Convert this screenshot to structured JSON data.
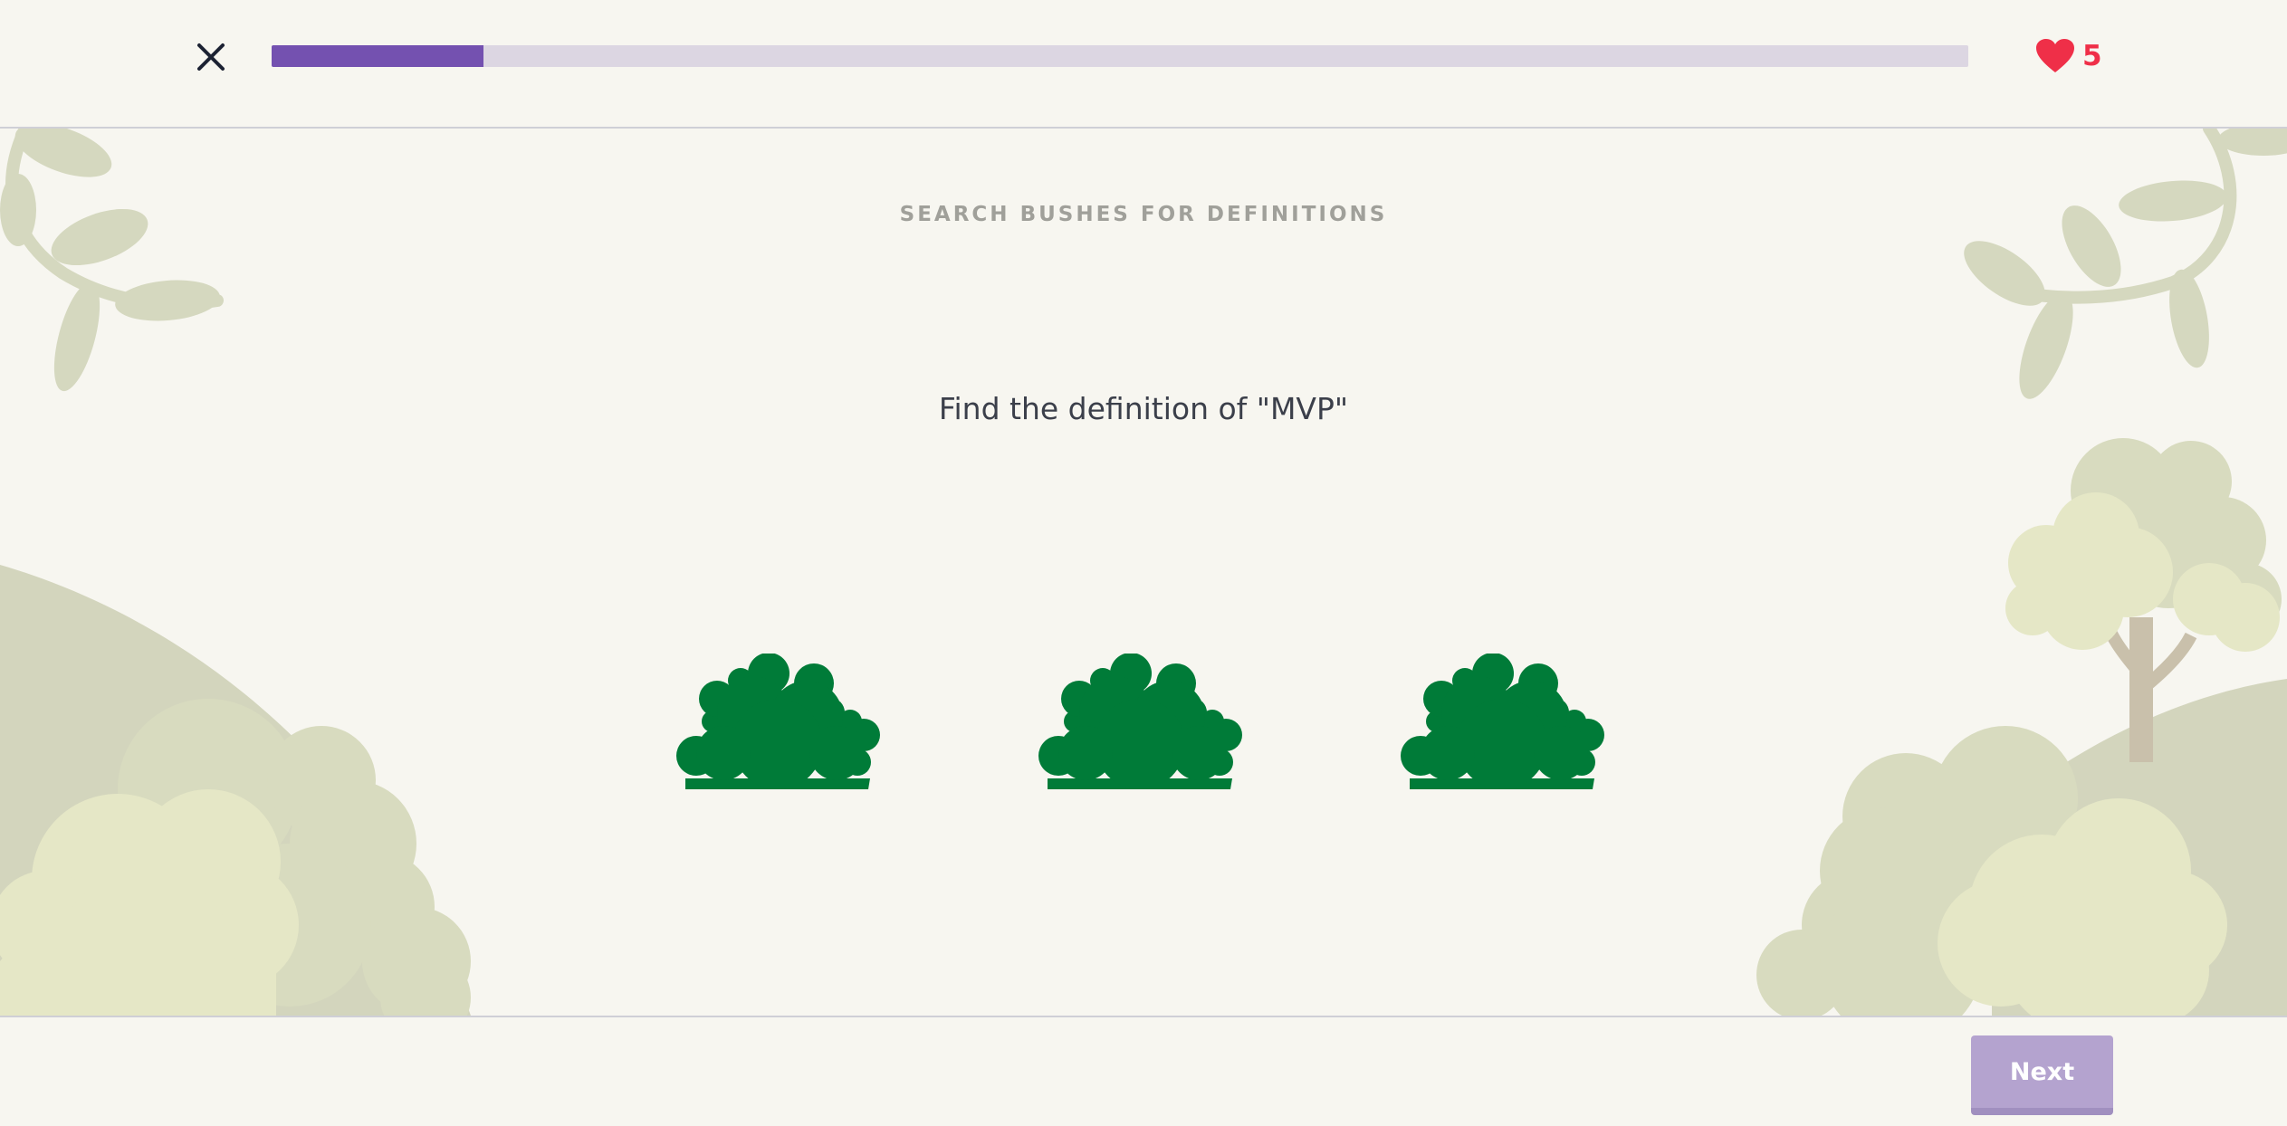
{
  "header": {
    "progress_fraction": 0.125,
    "progress_color": "#7451b0",
    "lives": "5",
    "heart_color": "#ef2f48"
  },
  "game": {
    "subtitle": "SEARCH BUSHES FOR DEFINITIONS",
    "prompt": "Find the definition of \"MVP\"",
    "bush_color": "#007b38",
    "bush_count": 3
  },
  "footer": {
    "next_label": "Next",
    "next_enabled": false
  }
}
